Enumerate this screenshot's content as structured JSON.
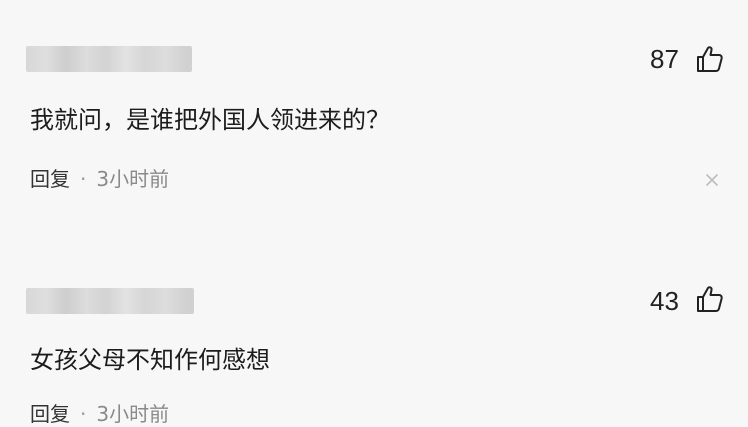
{
  "comments": [
    {
      "like_count": "87",
      "text": "我就问，是谁把外国人领进来的？",
      "reply_label": "回复",
      "separator": "·",
      "time": "3小时前"
    },
    {
      "like_count": "43",
      "text": "女孩父母不知作何感想",
      "reply_label": "回复",
      "separator": "·",
      "time": "3小时前"
    }
  ],
  "icons": {
    "like": "thumbs-up-icon",
    "dismiss": "close-icon"
  },
  "colors": {
    "background": "#f7f7f7",
    "text": "#1c1c1c",
    "meta": "#8a8a8a"
  }
}
